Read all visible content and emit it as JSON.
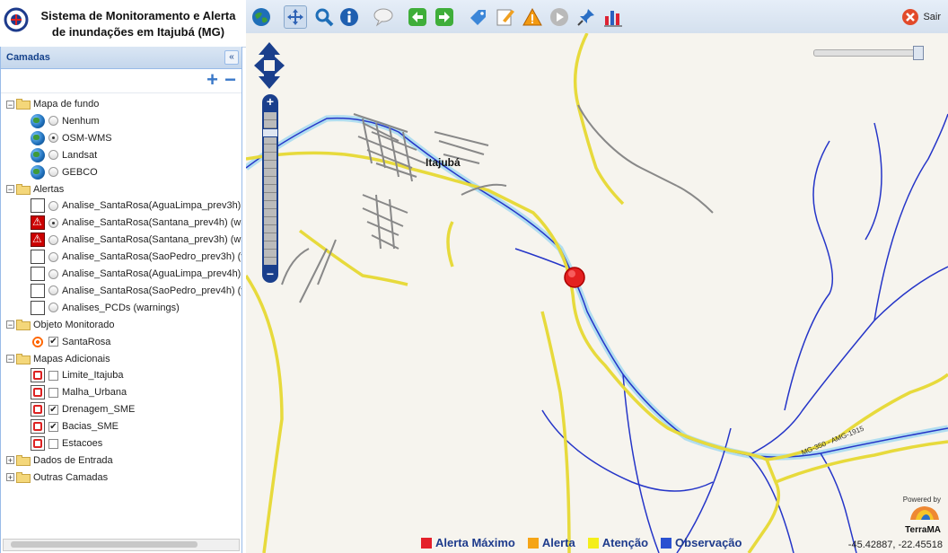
{
  "header": {
    "title_line1": "Sistema de Monitoramento e Alerta",
    "title_line2": "de inundações em Itajubá (MG)"
  },
  "sidebar": {
    "panel_title": "Camadas",
    "tree": [
      {
        "type": "group",
        "label": "Mapa de fundo",
        "expanded": true
      },
      {
        "type": "leaf",
        "icon": "globe-icon",
        "control": "radio",
        "checked": false,
        "label": "Nenhum"
      },
      {
        "type": "leaf",
        "icon": "globe-icon",
        "control": "radio",
        "checked": true,
        "label": "OSM-WMS"
      },
      {
        "type": "leaf",
        "icon": "globe-icon",
        "control": "radio",
        "checked": false,
        "label": "Landsat"
      },
      {
        "type": "leaf",
        "icon": "globe-icon",
        "control": "radio",
        "checked": false,
        "label": "GEBCO"
      },
      {
        "type": "group",
        "label": "Alertas",
        "expanded": true
      },
      {
        "type": "leaf",
        "icon": "blank-icon",
        "control": "radio",
        "checked": false,
        "label": "Analise_SantaRosa(AguaLimpa_prev3h) ("
      },
      {
        "type": "leaf",
        "icon": "warning-icon",
        "control": "radio",
        "checked": true,
        "label": "Analise_SantaRosa(Santana_prev4h) (wa"
      },
      {
        "type": "leaf",
        "icon": "warning-icon",
        "control": "radio",
        "checked": false,
        "label": "Analise_SantaRosa(Santana_prev3h) (wa"
      },
      {
        "type": "leaf",
        "icon": "blank-icon",
        "control": "radio",
        "checked": false,
        "label": "Analise_SantaRosa(SaoPedro_prev3h) (v"
      },
      {
        "type": "leaf",
        "icon": "blank-icon",
        "control": "radio",
        "checked": false,
        "label": "Analise_SantaRosa(AguaLimpa_prev4h) ("
      },
      {
        "type": "leaf",
        "icon": "blank-icon",
        "control": "radio",
        "checked": false,
        "label": "Analise_SantaRosa(SaoPedro_prev4h) (v"
      },
      {
        "type": "leaf",
        "icon": "blank-icon",
        "control": "radio",
        "checked": false,
        "label": "Analises_PCDs (warnings)"
      },
      {
        "type": "group",
        "label": "Objeto Monitorado",
        "expanded": true
      },
      {
        "type": "leaf",
        "icon": "target-icon",
        "control": "check",
        "checked": true,
        "label": "SantaRosa"
      },
      {
        "type": "group",
        "label": "Mapas Adicionais",
        "expanded": true
      },
      {
        "type": "leaf",
        "icon": "layer-icon",
        "control": "check",
        "checked": false,
        "label": "Limite_Itajuba"
      },
      {
        "type": "leaf",
        "icon": "layer-icon",
        "control": "check",
        "checked": false,
        "label": "Malha_Urbana"
      },
      {
        "type": "leaf",
        "icon": "layer-icon",
        "control": "check",
        "checked": true,
        "label": "Drenagem_SME"
      },
      {
        "type": "leaf",
        "icon": "layer-icon",
        "control": "check",
        "checked": true,
        "label": "Bacias_SME"
      },
      {
        "type": "leaf",
        "icon": "layer-icon",
        "control": "check",
        "checked": false,
        "label": "Estacoes"
      },
      {
        "type": "group",
        "label": "Dados de Entrada",
        "expanded": false
      },
      {
        "type": "group",
        "label": "Outras Camadas",
        "expanded": false
      }
    ]
  },
  "toolbar": {
    "buttons": [
      "globe-icon",
      "pan-icon",
      "zoom-icon",
      "info-icon",
      "comment-icon",
      "back-icon",
      "forward-icon",
      "tag-icon",
      "edit-icon",
      "alert-icon",
      "play-icon",
      "pin-icon",
      "chart-icon"
    ],
    "logout_label": "Sair"
  },
  "map": {
    "city_label": "Itajubá",
    "coordinates": "-45.42887, -22.45518",
    "powered_by": "Powered by",
    "brand": "TerraMA",
    "road_labels": [
      "MG-350 - AMG-1915"
    ],
    "legend": [
      {
        "label": "Alerta Máximo",
        "color": "#e4202a"
      },
      {
        "label": "Alerta",
        "color": "#f5a516"
      },
      {
        "label": "Atenção",
        "color": "#f4ee1a"
      },
      {
        "label": "Observação",
        "color": "#2a51d1"
      }
    ]
  }
}
